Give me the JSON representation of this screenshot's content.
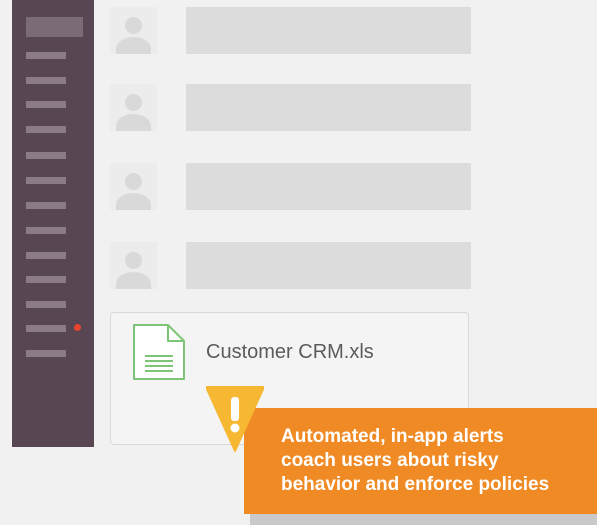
{
  "file": {
    "name": "Customer CRM.xls"
  },
  "alert": {
    "lines": [
      "Automated, in-app alerts",
      "coach users about risky",
      "behavior and enforce policies"
    ]
  },
  "icons": {
    "file": "spreadsheet-file-icon",
    "warning": "warning-icon",
    "avatar": "user-avatar-placeholder-icon",
    "notification_dot": "notification-dot"
  },
  "colors": {
    "sidebar": "#584653",
    "accent_alert": "#f08a24",
    "warning_icon": "#f6b833",
    "file_icon": "#7cc576",
    "notification_dot": "#e8432e"
  }
}
